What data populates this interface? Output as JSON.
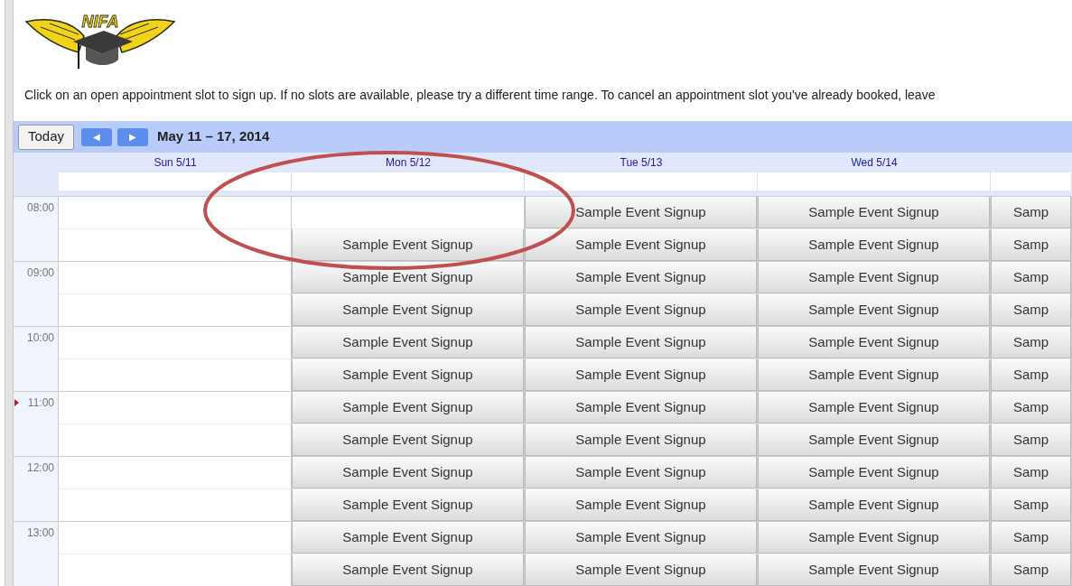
{
  "logo": {
    "text": "NIFA"
  },
  "instructions": "Click on an open appointment slot to sign up. If no slots are available, please try a different time range. To cancel an appointment slot you've already booked, leave",
  "toolbar": {
    "today": "Today",
    "prev": "◀",
    "next": "▶",
    "range": "May 11 – 17, 2014"
  },
  "hours": [
    {
      "label": "08:00",
      "now": false
    },
    {
      "label": "09:00",
      "now": false
    },
    {
      "label": "10:00",
      "now": false
    },
    {
      "label": "11:00",
      "now": true
    },
    {
      "label": "12:00",
      "now": false
    },
    {
      "label": "13:00",
      "now": false
    }
  ],
  "days": [
    {
      "label": "Sun 5/11",
      "slots": [
        {
          "kind": "empty"
        },
        {
          "kind": "empty"
        },
        {
          "kind": "empty"
        },
        {
          "kind": "empty"
        },
        {
          "kind": "empty"
        },
        {
          "kind": "empty"
        },
        {
          "kind": "empty"
        },
        {
          "kind": "empty"
        },
        {
          "kind": "empty"
        },
        {
          "kind": "empty"
        },
        {
          "kind": "empty"
        },
        {
          "kind": "empty"
        }
      ]
    },
    {
      "label": "Mon 5/12",
      "slots": [
        {
          "kind": "empty"
        },
        {
          "kind": "open",
          "label": "Sample Event Signup"
        },
        {
          "kind": "open",
          "label": "Sample Event Signup"
        },
        {
          "kind": "open",
          "label": "Sample Event Signup"
        },
        {
          "kind": "open",
          "label": "Sample Event Signup"
        },
        {
          "kind": "open",
          "label": "Sample Event Signup"
        },
        {
          "kind": "open",
          "label": "Sample Event Signup"
        },
        {
          "kind": "open",
          "label": "Sample Event Signup"
        },
        {
          "kind": "open",
          "label": "Sample Event Signup"
        },
        {
          "kind": "open",
          "label": "Sample Event Signup"
        },
        {
          "kind": "open",
          "label": "Sample Event Signup"
        },
        {
          "kind": "open",
          "label": "Sample Event Signup"
        }
      ]
    },
    {
      "label": "Tue 5/13",
      "slots": [
        {
          "kind": "open",
          "label": "Sample Event Signup"
        },
        {
          "kind": "open",
          "label": "Sample Event Signup"
        },
        {
          "kind": "open",
          "label": "Sample Event Signup"
        },
        {
          "kind": "open",
          "label": "Sample Event Signup"
        },
        {
          "kind": "open",
          "label": "Sample Event Signup"
        },
        {
          "kind": "open",
          "label": "Sample Event Signup"
        },
        {
          "kind": "open",
          "label": "Sample Event Signup"
        },
        {
          "kind": "open",
          "label": "Sample Event Signup"
        },
        {
          "kind": "open",
          "label": "Sample Event Signup"
        },
        {
          "kind": "open",
          "label": "Sample Event Signup"
        },
        {
          "kind": "open",
          "label": "Sample Event Signup"
        },
        {
          "kind": "open",
          "label": "Sample Event Signup"
        }
      ]
    },
    {
      "label": "Wed 5/14",
      "slots": [
        {
          "kind": "open",
          "label": "Sample Event Signup"
        },
        {
          "kind": "open",
          "label": "Sample Event Signup"
        },
        {
          "kind": "open",
          "label": "Sample Event Signup"
        },
        {
          "kind": "open",
          "label": "Sample Event Signup"
        },
        {
          "kind": "open",
          "label": "Sample Event Signup"
        },
        {
          "kind": "open",
          "label": "Sample Event Signup"
        },
        {
          "kind": "open",
          "label": "Sample Event Signup"
        },
        {
          "kind": "open",
          "label": "Sample Event Signup"
        },
        {
          "kind": "open",
          "label": "Sample Event Signup"
        },
        {
          "kind": "open",
          "label": "Sample Event Signup"
        },
        {
          "kind": "open",
          "label": "Sample Event Signup"
        },
        {
          "kind": "open",
          "label": "Sample Event Signup"
        }
      ]
    },
    {
      "slots": [
        {
          "kind": "open",
          "label": "Samp"
        },
        {
          "kind": "open",
          "label": "Samp"
        },
        {
          "kind": "open",
          "label": "Samp"
        },
        {
          "kind": "open",
          "label": "Samp"
        },
        {
          "kind": "open",
          "label": "Samp"
        },
        {
          "kind": "open",
          "label": "Samp"
        },
        {
          "kind": "open",
          "label": "Samp"
        },
        {
          "kind": "open",
          "label": "Samp"
        },
        {
          "kind": "open",
          "label": "Samp"
        },
        {
          "kind": "open",
          "label": "Samp"
        },
        {
          "kind": "open",
          "label": "Samp"
        },
        {
          "kind": "open",
          "label": "Samp"
        }
      ]
    }
  ]
}
